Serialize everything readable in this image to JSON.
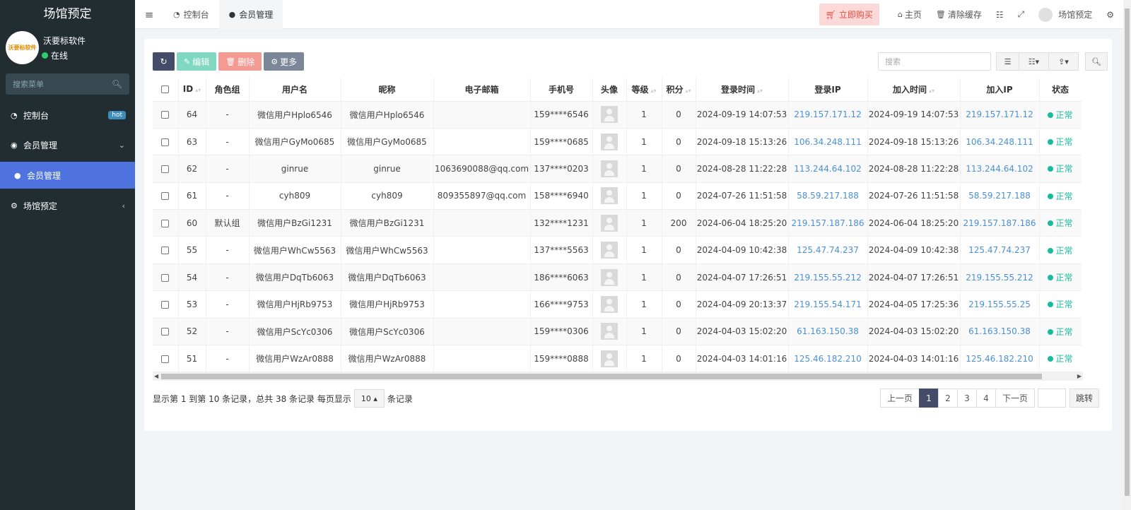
{
  "sidebar": {
    "brand": "场馆预定",
    "user_name": "沃要标软件",
    "user_status": "在线",
    "logo_text": "沃要标软件",
    "search_placeholder": "搜索菜单",
    "items": [
      {
        "label": "控制台",
        "badge": "hot",
        "icon": "dashboard-icon"
      },
      {
        "label": "会员管理",
        "icon": "user-circle-icon"
      },
      {
        "label": "会员管理",
        "icon": "user-icon",
        "active": true
      },
      {
        "label": "场馆预定",
        "icon": "gears-icon"
      }
    ]
  },
  "topbar": {
    "tabs": [
      {
        "label": "控制台",
        "icon": "dashboard-icon"
      },
      {
        "label": "会员管理",
        "icon": "user-icon",
        "active": true
      }
    ],
    "buy_label": "立即购买",
    "home_label": "主页",
    "clear_cache_label": "清除缓存",
    "account_label": "场馆预定"
  },
  "toolbar": {
    "edit_label": "编辑",
    "delete_label": "删除",
    "more_label": "更多",
    "search_placeholder": "搜索"
  },
  "table": {
    "headers": [
      "ID",
      "角色组",
      "用户名",
      "昵称",
      "电子邮箱",
      "手机号",
      "头像",
      "等级",
      "积分",
      "登录时间",
      "登录IP",
      "加入时间",
      "加入IP",
      "状态"
    ],
    "rows": [
      {
        "id": "64",
        "group": "-",
        "username": "微信用户Hplo6546",
        "nickname": "微信用户Hplo6546",
        "email": "",
        "mobile": "159****6546",
        "level": "1",
        "score": "0",
        "logintime": "2024-09-19 14:07:53",
        "loginip": "219.157.171.12",
        "jointime": "2024-09-19 14:07:53",
        "joinip": "219.157.171.12",
        "status": "正常"
      },
      {
        "id": "63",
        "group": "-",
        "username": "微信用户GyMo0685",
        "nickname": "微信用户GyMo0685",
        "email": "",
        "mobile": "159****0685",
        "level": "1",
        "score": "0",
        "logintime": "2024-09-18 15:13:26",
        "loginip": "106.34.248.111",
        "jointime": "2024-09-18 15:13:26",
        "joinip": "106.34.248.111",
        "status": "正常"
      },
      {
        "id": "62",
        "group": "-",
        "username": "ginrue",
        "nickname": "ginrue",
        "email": "1063690088@qq.com",
        "mobile": "137****0203",
        "level": "1",
        "score": "0",
        "logintime": "2024-08-28 11:22:28",
        "loginip": "113.244.64.102",
        "jointime": "2024-08-28 11:22:28",
        "joinip": "113.244.64.102",
        "status": "正常"
      },
      {
        "id": "61",
        "group": "-",
        "username": "cyh809",
        "nickname": "cyh809",
        "email": "809355897@qq.com",
        "mobile": "158****6940",
        "level": "1",
        "score": "0",
        "logintime": "2024-07-26 11:51:58",
        "loginip": "58.59.217.188",
        "jointime": "2024-07-26 11:51:58",
        "joinip": "58.59.217.188",
        "status": "正常"
      },
      {
        "id": "60",
        "group": "默认组",
        "username": "微信用户BzGi1231",
        "nickname": "微信用户BzGi1231",
        "email": "",
        "mobile": "132****1231",
        "level": "1",
        "score": "200",
        "logintime": "2024-06-04 18:25:20",
        "loginip": "219.157.187.186",
        "jointime": "2024-06-04 18:25:20",
        "joinip": "219.157.187.186",
        "status": "正常"
      },
      {
        "id": "55",
        "group": "-",
        "username": "微信用户WhCw5563",
        "nickname": "微信用户WhCw5563",
        "email": "",
        "mobile": "137****5563",
        "level": "1",
        "score": "0",
        "logintime": "2024-04-09 10:42:38",
        "loginip": "125.47.74.237",
        "jointime": "2024-04-09 10:42:38",
        "joinip": "125.47.74.237",
        "status": "正常"
      },
      {
        "id": "54",
        "group": "-",
        "username": "微信用户DqTb6063",
        "nickname": "微信用户DqTb6063",
        "email": "",
        "mobile": "186****6063",
        "level": "1",
        "score": "0",
        "logintime": "2024-04-07 17:26:51",
        "loginip": "219.155.55.212",
        "jointime": "2024-04-07 17:26:51",
        "joinip": "219.155.55.212",
        "status": "正常"
      },
      {
        "id": "53",
        "group": "-",
        "username": "微信用户HjRb9753",
        "nickname": "微信用户HjRb9753",
        "email": "",
        "mobile": "166****9753",
        "level": "1",
        "score": "0",
        "logintime": "2024-04-09 20:13:37",
        "loginip": "219.155.54.171",
        "jointime": "2024-04-05 17:25:36",
        "joinip": "219.155.55.25",
        "status": "正常"
      },
      {
        "id": "52",
        "group": "-",
        "username": "微信用户ScYc0306",
        "nickname": "微信用户ScYc0306",
        "email": "",
        "mobile": "159****0306",
        "level": "1",
        "score": "0",
        "logintime": "2024-04-03 15:02:20",
        "loginip": "61.163.150.38",
        "jointime": "2024-04-03 15:02:20",
        "joinip": "61.163.150.38",
        "status": "正常"
      },
      {
        "id": "51",
        "group": "-",
        "username": "微信用户WzAr0888",
        "nickname": "微信用户WzAr0888",
        "email": "",
        "mobile": "159****0888",
        "level": "1",
        "score": "0",
        "logintime": "2024-04-03 14:01:16",
        "loginip": "125.46.182.210",
        "jointime": "2024-04-03 14:01:16",
        "joinip": "125.46.182.210",
        "status": "正常"
      }
    ]
  },
  "pagination": {
    "info": "显示第 1 到第 10 条记录，总共 38 条记录 每页显示",
    "page_size": "10",
    "info_suffix": "条记录",
    "prev_label": "上一页",
    "next_label": "下一页",
    "pages": [
      "1",
      "2",
      "3",
      "4"
    ],
    "current": "1",
    "jump_label": "跳转"
  }
}
